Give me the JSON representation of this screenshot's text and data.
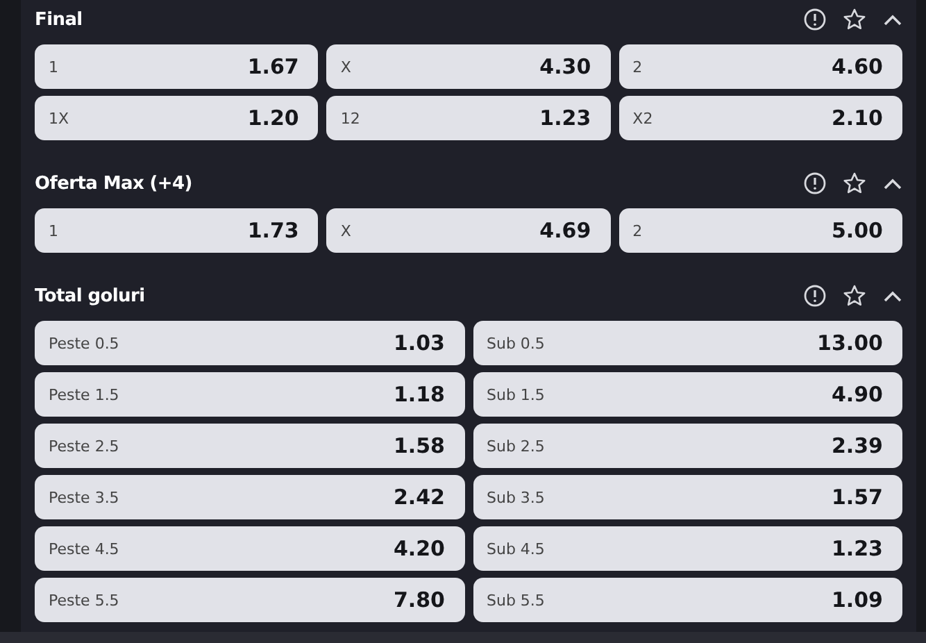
{
  "markets": [
    {
      "title": "Final",
      "expanded": true,
      "rows": [
        [
          {
            "label": "1",
            "odds": "1.67"
          },
          {
            "label": "X",
            "odds": "4.30"
          },
          {
            "label": "2",
            "odds": "4.60"
          }
        ],
        [
          {
            "label": "1X",
            "odds": "1.20"
          },
          {
            "label": "12",
            "odds": "1.23"
          },
          {
            "label": "X2",
            "odds": "2.10"
          }
        ]
      ]
    },
    {
      "title": "Oferta Max (+4)",
      "expanded": true,
      "rows": [
        [
          {
            "label": "1",
            "odds": "1.73"
          },
          {
            "label": "X",
            "odds": "4.69"
          },
          {
            "label": "2",
            "odds": "5.00"
          }
        ]
      ]
    },
    {
      "title": "Total goluri",
      "expanded": true,
      "rows": [
        [
          {
            "label": "Peste 0.5",
            "odds": "1.03"
          },
          {
            "label": "Sub 0.5",
            "odds": "13.00"
          }
        ],
        [
          {
            "label": "Peste 1.5",
            "odds": "1.18"
          },
          {
            "label": "Sub 1.5",
            "odds": "4.90"
          }
        ],
        [
          {
            "label": "Peste 2.5",
            "odds": "1.58"
          },
          {
            "label": "Sub 2.5",
            "odds": "2.39"
          }
        ],
        [
          {
            "label": "Peste 3.5",
            "odds": "2.42"
          },
          {
            "label": "Sub 3.5",
            "odds": "1.57"
          }
        ],
        [
          {
            "label": "Peste 4.5",
            "odds": "4.20"
          },
          {
            "label": "Sub 4.5",
            "odds": "1.23"
          }
        ],
        [
          {
            "label": "Peste 5.5",
            "odds": "7.80"
          },
          {
            "label": "Sub 5.5",
            "odds": "1.09"
          }
        ]
      ]
    }
  ]
}
